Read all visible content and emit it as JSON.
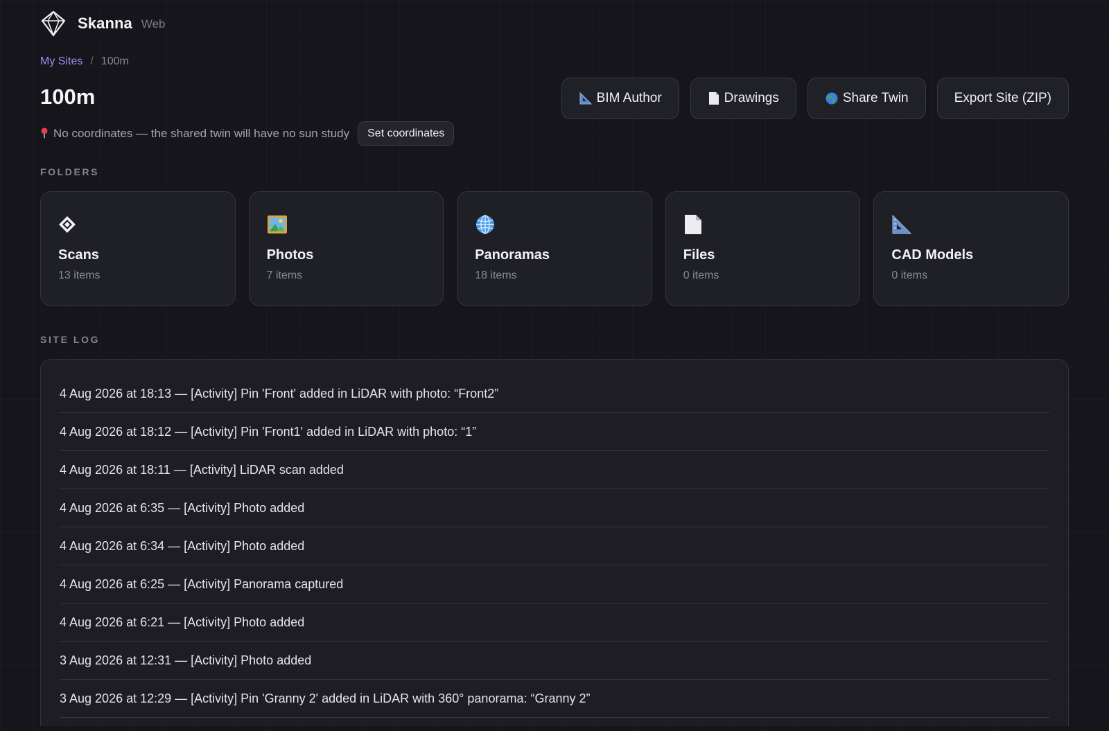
{
  "brand": {
    "name": "Skanna",
    "sub": "Web",
    "logo_icon": "diamond-logo-icon"
  },
  "breadcrumb": {
    "root": "My Sites",
    "separator": "/",
    "current": "100m"
  },
  "page": {
    "title": "100m",
    "coord_icon": "pin-icon",
    "coord_notice": "No coordinates — the shared twin will have no sun study",
    "set_coords_label": "Set coordinates"
  },
  "actions": {
    "bim_author": "BIM Author",
    "drawings": "Drawings",
    "share_twin": "Share Twin",
    "export_site": "Export Site (ZIP)"
  },
  "folders": {
    "label": "FOLDERS",
    "items": [
      {
        "name": "Scans",
        "count": "13 items",
        "icon": "diamond-icon"
      },
      {
        "name": "Photos",
        "count": "7 items",
        "icon": "picture-icon"
      },
      {
        "name": "Panoramas",
        "count": "18 items",
        "icon": "globe-icon"
      },
      {
        "name": "Files",
        "count": "0 items",
        "icon": "document-icon"
      },
      {
        "name": "CAD Models",
        "count": "0 items",
        "icon": "triangle-ruler-icon"
      }
    ]
  },
  "site_log": {
    "label": "SITE LOG",
    "entries": [
      "4 Aug 2026 at 18:13 — [Activity] Pin 'Front' added in LiDAR with photo: “Front2”",
      "4 Aug 2026 at 18:12 — [Activity] Pin 'Front1' added in LiDAR with photo: “1”",
      "4 Aug 2026 at 18:11 — [Activity] LiDAR scan added",
      "4 Aug 2026 at 6:35 — [Activity] Photo added",
      "4 Aug 2026 at 6:34 — [Activity] Photo added",
      "4 Aug 2026 at 6:25 — [Activity] Panorama captured",
      "4 Aug 2026 at 6:21 — [Activity] Photo added",
      "3 Aug 2026 at 12:31 — [Activity] Photo added",
      "3 Aug 2026 at 12:29 — [Activity] Pin 'Granny 2' added in LiDAR with 360° panorama: “Granny 2”"
    ]
  },
  "colors": {
    "accent": "#9d8ff0",
    "background": "#15151b",
    "card": "#1f1f26",
    "pin": "#e0414a"
  }
}
